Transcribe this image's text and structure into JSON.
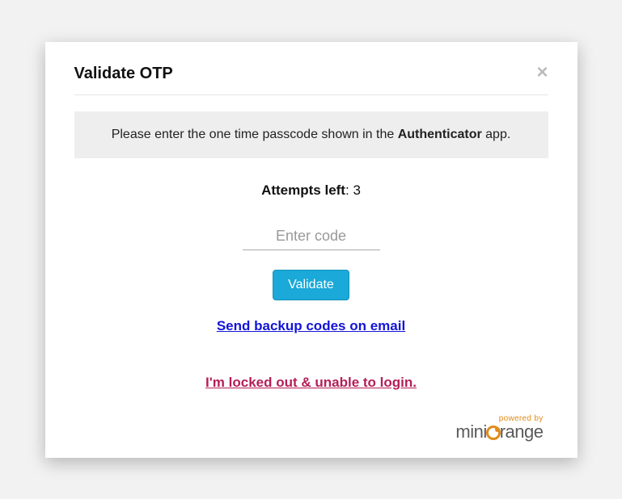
{
  "modal": {
    "title": "Validate OTP",
    "instruction_prefix": "Please enter the one time passcode shown in the ",
    "instruction_bold": "Authenticator",
    "instruction_suffix": " app.",
    "attempts_label": "Attempts left",
    "attempts_separator": ": ",
    "attempts_value": "3",
    "code_placeholder": "Enter code",
    "validate_label": "Validate",
    "backup_link_label": "Send backup codes on email",
    "locked_link_label": "I'm locked out & unable to login.",
    "powered_label": "powered by",
    "brand_mini": "mini",
    "brand_range": "range"
  }
}
